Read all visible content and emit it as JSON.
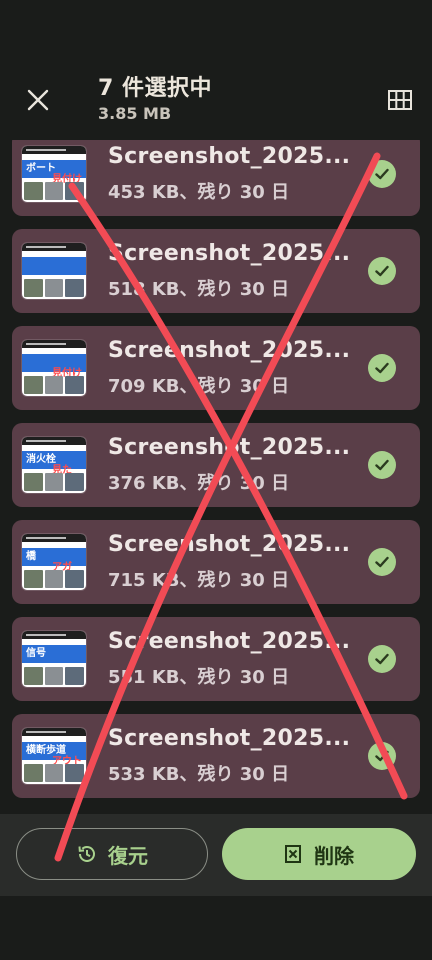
{
  "header": {
    "title": "7 件選択中",
    "subtitle": "3.85 MB",
    "close_icon": "close-icon",
    "grid_icon": "grid-view-icon"
  },
  "items": [
    {
      "name": "Screenshot_2025...",
      "meta": "453 KB、残り 30 日",
      "thumb_text": "ボート",
      "thumb_red": "見付け"
    },
    {
      "name": "Screenshot_2025...",
      "meta": "518 KB、残り 30 日",
      "thumb_text": "",
      "thumb_red": ""
    },
    {
      "name": "Screenshot_2025...",
      "meta": "709 KB、残り 30 日",
      "thumb_text": "",
      "thumb_red": "見付け"
    },
    {
      "name": "Screenshot_2025...",
      "meta": "376 KB、残り 30 日",
      "thumb_text": "消火栓",
      "thumb_red": "見た"
    },
    {
      "name": "Screenshot_2025...",
      "meta": "715 KB、残り 30 日",
      "thumb_text": "橋",
      "thumb_red": "アガ"
    },
    {
      "name": "Screenshot_2025...",
      "meta": "551 KB、残り 30 日",
      "thumb_text": "信号",
      "thumb_red": ""
    },
    {
      "name": "Screenshot_2025...",
      "meta": "533 KB、残り 30 日",
      "thumb_text": "横断歩道",
      "thumb_red": "アウト"
    }
  ],
  "actions": {
    "restore_label": "復元",
    "delete_label": "削除",
    "restore_icon": "restore-history-icon",
    "delete_icon": "delete-box-icon"
  },
  "colors": {
    "item_bg": "#5a3e48",
    "check": "#a8d18d",
    "delete_bg": "#a8d18d",
    "annotation_red": "#f24b55"
  }
}
